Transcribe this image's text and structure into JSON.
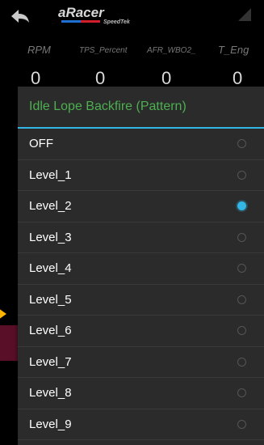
{
  "header": {
    "logo_text": "aRacer",
    "logo_sub": "SpeedTek"
  },
  "gauges": [
    {
      "label": "RPM",
      "value": "0"
    },
    {
      "label": "TPS_Percent",
      "value": "0"
    },
    {
      "label": "AFR_WBO2_",
      "value": "0"
    },
    {
      "label": "T_Eng",
      "value": "0"
    }
  ],
  "dialog": {
    "title": "Idle Lope Backfire (Pattern)",
    "selected_index": 2,
    "options": [
      "OFF",
      "Level_1",
      "Level_2",
      "Level_3",
      "Level_4",
      "Level_5",
      "Level_6",
      "Level_7",
      "Level_8",
      "Level_9"
    ]
  },
  "colors": {
    "title": "#4caf50",
    "accent": "#33b5e5",
    "highlight_row": "#5a0f28"
  }
}
